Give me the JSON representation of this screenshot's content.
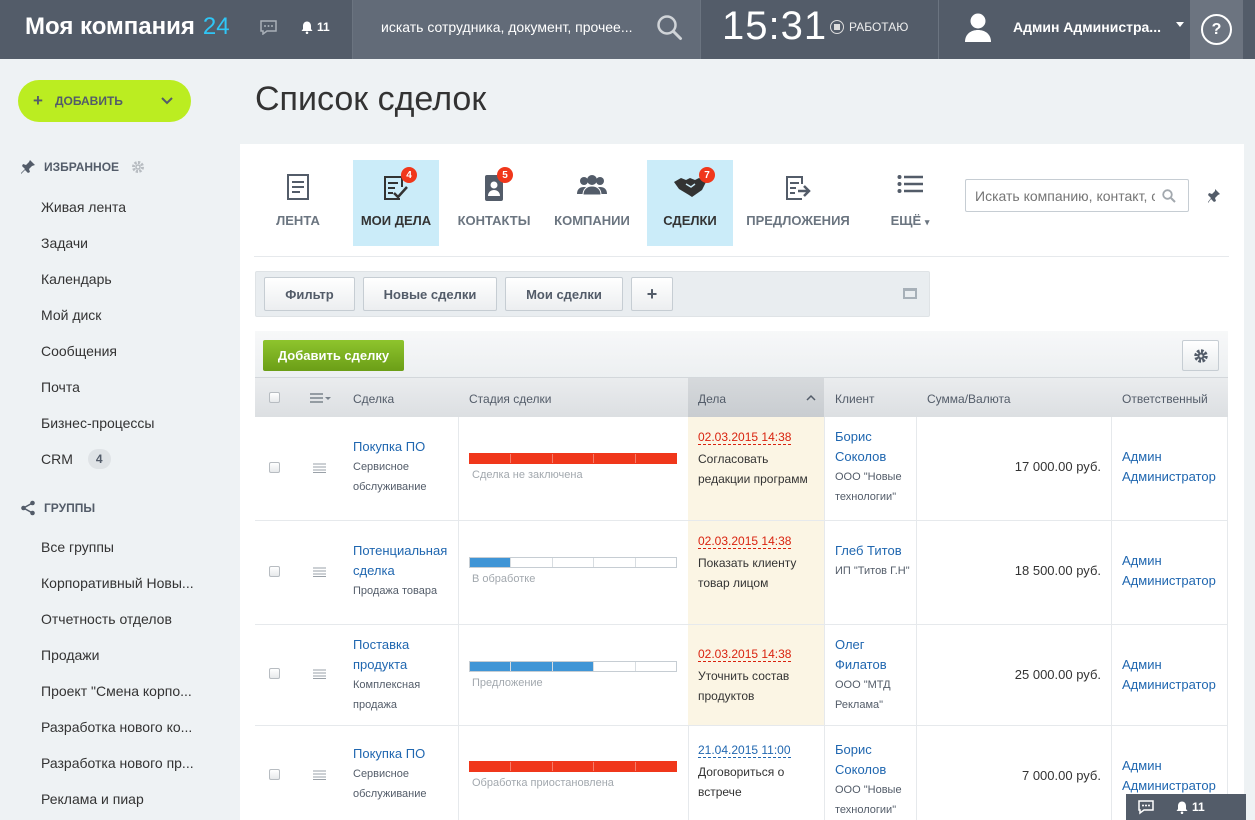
{
  "header": {
    "logo_text": "Моя компания",
    "logo_num": "24",
    "notifications_count": "11",
    "search_placeholder": "искать сотрудника, документ, прочее...",
    "clock": "15:31",
    "status": "РАБОТАЮ",
    "user_name": "Админ Администра...",
    "help": "?"
  },
  "sidebar": {
    "add_button": "ДОБАВИТЬ",
    "favorites_title": "ИЗБРАННОЕ",
    "favorites": [
      "Живая лента",
      "Задачи",
      "Календарь",
      "Мой диск",
      "Сообщения",
      "Почта",
      "Бизнес-процессы",
      "CRM"
    ],
    "crm_badge": "4",
    "groups_title": "ГРУППЫ",
    "groups": [
      "Все группы",
      "Корпоративный Новы...",
      "Отчетность отделов",
      "Продажи",
      "Проект \"Смена корпо...",
      "Разработка нового ко...",
      "Разработка нового пр...",
      "Реклама и пиар"
    ]
  },
  "page": {
    "title": "Список сделок"
  },
  "tabs": [
    {
      "label": "ЛЕНТА",
      "icon": "feed-icon",
      "badge": "",
      "active": false
    },
    {
      "label": "МОИ ДЕЛА",
      "icon": "checklist-icon",
      "badge": "4",
      "active": true
    },
    {
      "label": "КОНТАКТЫ",
      "icon": "contact-book-icon",
      "badge": "5",
      "active": false
    },
    {
      "label": "КОМПАНИИ",
      "icon": "people-icon",
      "badge": "",
      "active": false
    },
    {
      "label": "СДЕЛКИ",
      "icon": "handshake-icon",
      "badge": "7",
      "active": true
    },
    {
      "label": "ПРЕДЛОЖЕНИЯ",
      "icon": "document-arrow-icon",
      "badge": "",
      "active": false
    },
    {
      "label": "ЕЩЁ",
      "icon": "list-icon",
      "badge": "",
      "active": false
    }
  ],
  "crm_search_placeholder": "Искать компанию, контакт, сд",
  "filters": {
    "filter": "Фильтр",
    "new_deals": "Новые сделки",
    "my_deals": "Мои сделки",
    "add": "+"
  },
  "toolbar": {
    "add_deal": "Добавить сделку"
  },
  "columns": {
    "deal": "Сделка",
    "stage": "Стадия сделки",
    "activities": "Дела",
    "client": "Клиент",
    "sum": "Сумма/Валюта",
    "responsible": "Ответственный"
  },
  "colors": {
    "accent_green": "#bbed21",
    "link_blue": "#2067b0",
    "stage_red": "#f0371b",
    "stage_blue": "#3f95d6",
    "overdue_red": "#d9230f",
    "badge_red": "#f0371b"
  },
  "rows": [
    {
      "title": "Покупка ПО",
      "type": "Сервисное обслуживание",
      "stage_label": "Сделка не заключена",
      "stage_fill": 5,
      "stage_color": "#f0371b",
      "activity_date": "02.03.2015 14:38",
      "activity_overdue": true,
      "activity_text": "Согласовать редакции программ",
      "client_name": "Борис Соколов",
      "client_company": "ООО \"Новые технологии\"",
      "sum": "17 000.00 руб.",
      "responsible": "Админ Администратор"
    },
    {
      "title": "Потенциальная сделка",
      "type": "Продажа товара",
      "stage_label": "В обработке",
      "stage_fill": 1,
      "stage_color": "#3f95d6",
      "activity_date": "02.03.2015 14:38",
      "activity_overdue": true,
      "activity_text": "Показать клиенту товар лицом",
      "client_name": "Глеб Титов",
      "client_company": "ИП \"Титов Г.Н\"",
      "sum": "18 500.00 руб.",
      "responsible": "Админ Администратор"
    },
    {
      "title": "Поставка продукта",
      "type": "Комплексная продажа",
      "stage_label": "Предложение",
      "stage_fill": 3,
      "stage_color": "#3f95d6",
      "activity_date": "02.03.2015 14:38",
      "activity_overdue": true,
      "activity_text": "Уточнить состав продуктов",
      "client_name": "Олег Филатов",
      "client_company": "ООО \"МТД Реклама\"",
      "sum": "25 000.00 руб.",
      "responsible": "Админ Администратор"
    },
    {
      "title": "Покупка ПО",
      "type": "Сервисное обслуживание",
      "stage_label": "Обработка приостановлена",
      "stage_fill": 5,
      "stage_color": "#f0371b",
      "activity_date": "21.04.2015 11:00",
      "activity_overdue": false,
      "activity_text": "Договориться о встрече",
      "client_name": "Борис Соколов",
      "client_company": "ООО \"Новые технологии\"",
      "sum": "7 000.00 руб.",
      "responsible": "Админ Администратор"
    }
  ],
  "bottom_bar": {
    "notifications": "11"
  }
}
